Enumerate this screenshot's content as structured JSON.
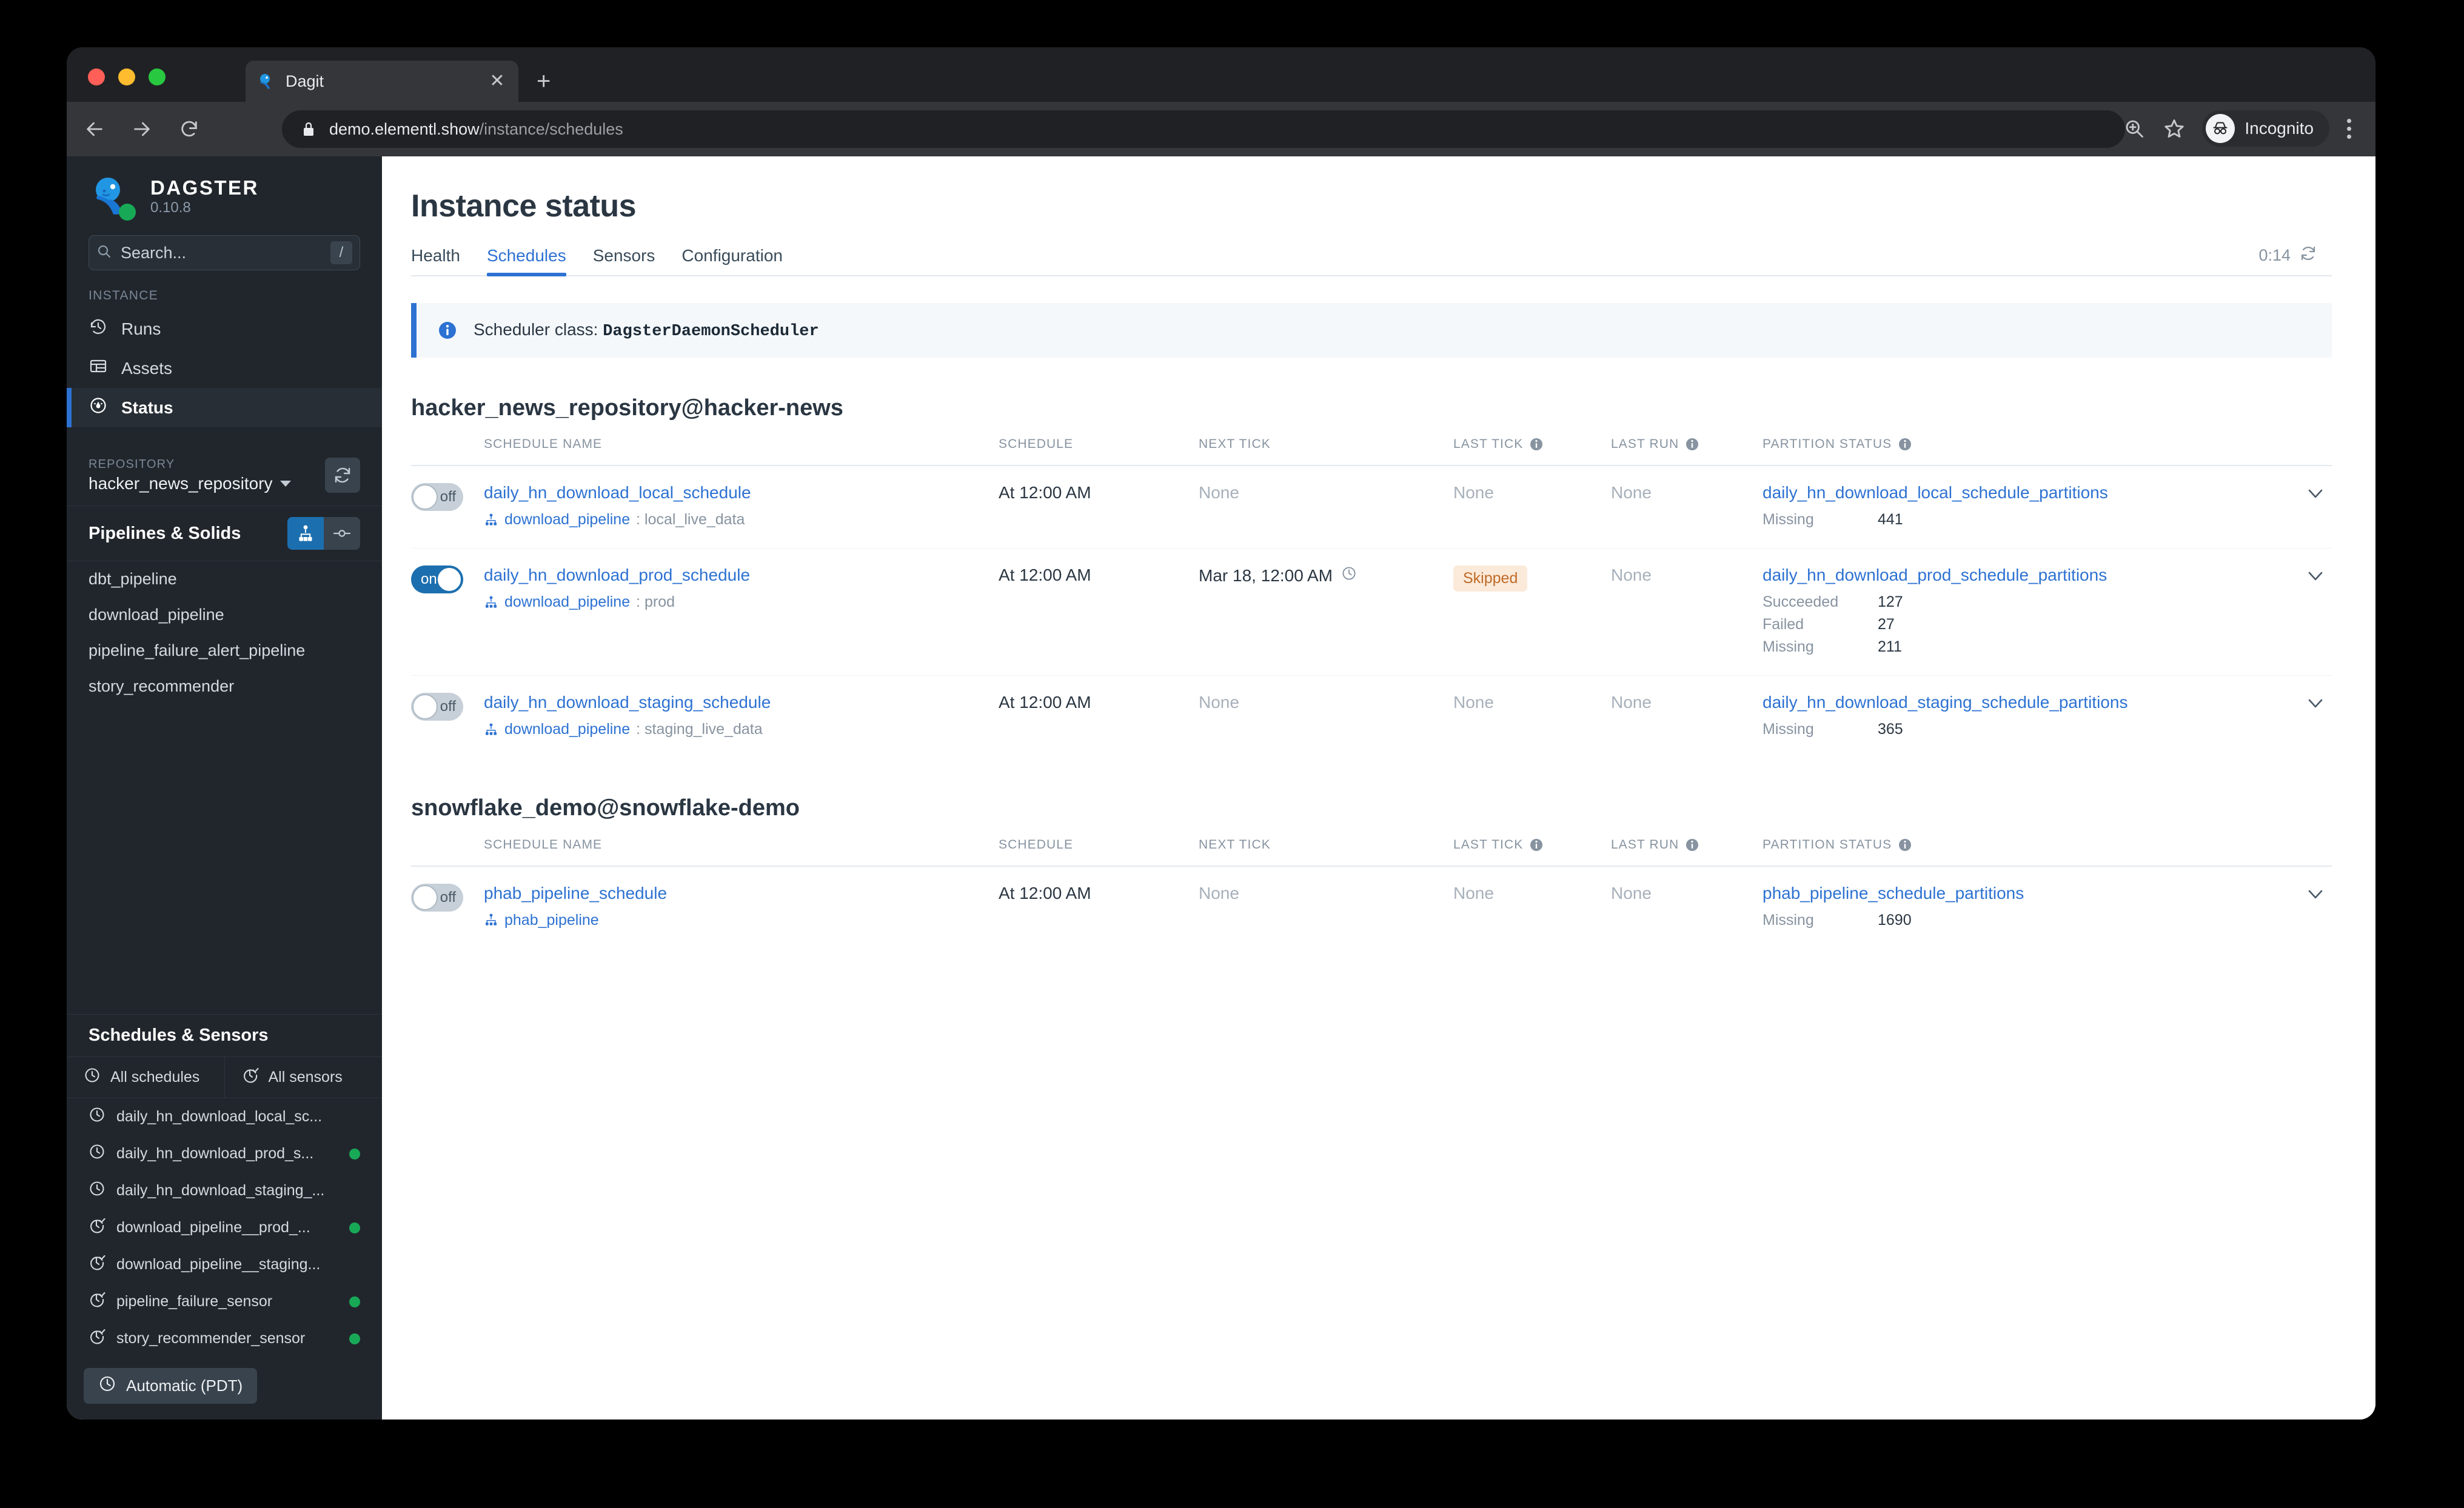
{
  "browser": {
    "tab_title": "Dagit",
    "tab_favicon_icon": "dagster-icon",
    "close_tab_glyph": "✕",
    "new_tab_glyph": "+",
    "url_host": "demo.elementl.show",
    "url_path": "/instance/schedules",
    "profile_label": "Incognito",
    "icons": {
      "back": "back-arrow-icon",
      "forward": "forward-arrow-icon",
      "reload": "reload-icon",
      "lock": "lock-icon",
      "zoom": "zoom-icon",
      "bookmark": "star-icon",
      "menu": "kebab-menu-icon"
    }
  },
  "sidebar": {
    "brand": {
      "name": "DAGSTER",
      "version": "0.10.8",
      "status_color": "#18A957"
    },
    "search": {
      "placeholder": "Search...",
      "shortcut": "/"
    },
    "instance_label": "INSTANCE",
    "nav": [
      {
        "label": "Runs",
        "icon": "history-clock-icon",
        "active": false
      },
      {
        "label": "Assets",
        "icon": "table-icon",
        "active": false
      },
      {
        "label": "Status",
        "icon": "gauge-icon",
        "active": true
      }
    ],
    "repository": {
      "label": "REPOSITORY",
      "name": "hacker_news_repository",
      "reload_icon": "reload-icon"
    },
    "pipelines": {
      "title": "Pipelines & Solids",
      "view_toggle": [
        {
          "icon": "pipeline-graph-icon",
          "selected": true
        },
        {
          "icon": "solid-node-icon",
          "selected": false
        }
      ],
      "items": [
        "dbt_pipeline",
        "download_pipeline",
        "pipeline_failure_alert_pipeline",
        "story_recommender"
      ]
    },
    "schedules_sensors": {
      "title": "Schedules & Sensors",
      "all_schedules": "All schedules",
      "all_sensors": "All sensors",
      "items": [
        {
          "label": "daily_hn_download_local_sc...",
          "icon": "clock-icon",
          "running": false
        },
        {
          "label": "daily_hn_download_prod_s...",
          "icon": "clock-icon",
          "running": true
        },
        {
          "label": "daily_hn_download_staging_...",
          "icon": "clock-icon",
          "running": false
        },
        {
          "label": "download_pipeline__prod_...",
          "icon": "sensor-icon",
          "running": true
        },
        {
          "label": "download_pipeline__staging...",
          "icon": "sensor-icon",
          "running": false
        },
        {
          "label": "pipeline_failure_sensor",
          "icon": "sensor-icon",
          "running": true
        },
        {
          "label": "story_recommender_sensor",
          "icon": "sensor-icon",
          "running": true
        }
      ]
    },
    "timezone_chip": {
      "label": "Automatic (PDT)",
      "icon": "clock-icon"
    }
  },
  "main": {
    "page_title": "Instance status",
    "tabs": [
      {
        "label": "Health",
        "selected": false
      },
      {
        "label": "Schedules",
        "selected": true
      },
      {
        "label": "Sensors",
        "selected": false
      },
      {
        "label": "Configuration",
        "selected": false
      }
    ],
    "timer": {
      "value": "0:14",
      "icon": "refresh-icon"
    },
    "banner": {
      "icon": "info-icon",
      "prefix": "Scheduler class: ",
      "value": "DagsterDaemonScheduler"
    },
    "columns": [
      "SCHEDULE NAME",
      "SCHEDULE",
      "NEXT TICK",
      "LAST TICK",
      "LAST RUN",
      "PARTITION STATUS"
    ],
    "sections": [
      {
        "title": "hacker_news_repository@hacker-news",
        "rows": [
          {
            "toggle": "off",
            "name": "daily_hn_download_local_schedule",
            "pipeline": "download_pipeline",
            "mode": "local_live_data",
            "schedule": "At 12:00 AM",
            "next_tick": "None",
            "next_tick_muted": true,
            "last_tick": "None",
            "last_tick_badge": null,
            "last_run": "None",
            "partition_link": "daily_hn_download_local_schedule_partitions",
            "partition_stats": [
              {
                "key": "Missing",
                "value": "441"
              }
            ]
          },
          {
            "toggle": "on",
            "name": "daily_hn_download_prod_schedule",
            "pipeline": "download_pipeline",
            "mode": "prod",
            "schedule": "At 12:00 AM",
            "next_tick": "Mar 18, 12:00 AM",
            "next_tick_muted": false,
            "last_tick": null,
            "last_tick_badge": "Skipped",
            "last_run": "None",
            "partition_link": "daily_hn_download_prod_schedule_partitions",
            "partition_stats": [
              {
                "key": "Succeeded",
                "value": "127"
              },
              {
                "key": "Failed",
                "value": "27"
              },
              {
                "key": "Missing",
                "value": "211"
              }
            ]
          },
          {
            "toggle": "off",
            "name": "daily_hn_download_staging_schedule",
            "pipeline": "download_pipeline",
            "mode": "staging_live_data",
            "schedule": "At 12:00 AM",
            "next_tick": "None",
            "next_tick_muted": true,
            "last_tick": "None",
            "last_tick_badge": null,
            "last_run": "None",
            "partition_link": "daily_hn_download_staging_schedule_partitions",
            "partition_stats": [
              {
                "key": "Missing",
                "value": "365"
              }
            ]
          }
        ]
      },
      {
        "title": "snowflake_demo@snowflake-demo",
        "rows": [
          {
            "toggle": "off",
            "name": "phab_pipeline_schedule",
            "pipeline": "phab_pipeline",
            "mode": "",
            "schedule": "At 12:00 AM",
            "next_tick": "None",
            "next_tick_muted": true,
            "last_tick": "None",
            "last_tick_badge": null,
            "last_run": "None",
            "partition_link": "phab_pipeline_schedule_partitions",
            "partition_stats": [
              {
                "key": "Missing",
                "value": "1690"
              }
            ]
          }
        ]
      }
    ],
    "colors": {
      "accent": "#2D72D2",
      "toggle_on": "#1C6FAF",
      "badge_skipped_bg": "#FBEADA",
      "badge_skipped_fg": "#C06A26"
    }
  }
}
